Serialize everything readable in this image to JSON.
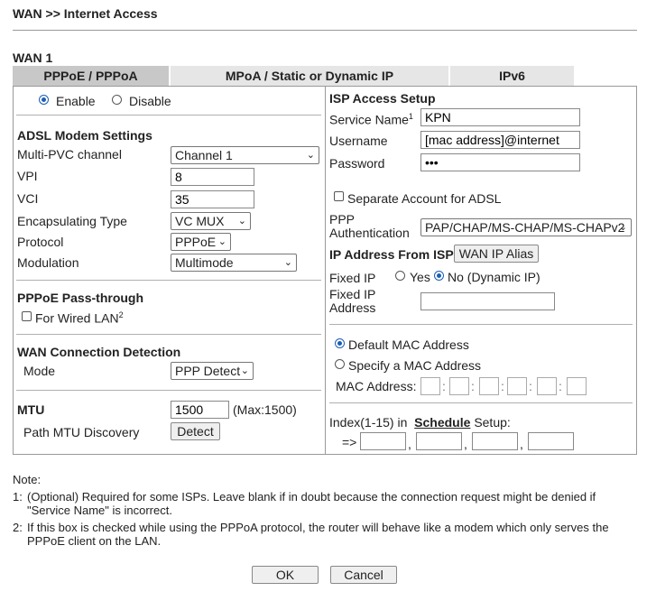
{
  "breadcrumb": "WAN >> Internet Access",
  "wan_title": "WAN 1",
  "tabs": [
    "PPPoE / PPPoA",
    "MPoA / Static or Dynamic IP",
    "IPv6"
  ],
  "left": {
    "enable": "Enable",
    "disable": "Disable",
    "adsl_title": "ADSL Modem Settings",
    "multipvc_label": "Multi-PVC channel",
    "multipvc_value": "Channel 1",
    "vpi_label": "VPI",
    "vpi_value": "8",
    "vci_label": "VCI",
    "vci_value": "35",
    "encap_label": "Encapsulating Type",
    "encap_value": "VC MUX",
    "protocol_label": "Protocol",
    "protocol_value": "PPPoE",
    "modulation_label": "Modulation",
    "modulation_value": "Multimode",
    "passthrough_title": "PPPoE Pass-through",
    "wired_lan": "For Wired LAN",
    "wired_lan_sup": "2",
    "detection_title": "WAN Connection Detection",
    "mode_label": "Mode",
    "mode_value": "PPP Detect",
    "mtu_label": "MTU",
    "mtu_value": "1500",
    "mtu_max": "(Max:1500)",
    "pmtu_label": "Path MTU Discovery",
    "detect_button": "Detect"
  },
  "right": {
    "isp_title": "ISP Access Setup",
    "service_name_label": "Service Name",
    "service_name_sup": "1",
    "service_name_value": "KPN",
    "username_label": "Username",
    "username_value": "[mac address]@internet",
    "password_label": "Password",
    "password_value": "•••",
    "separate_account": "Separate Account for ADSL",
    "ppp_auth_label_1": "PPP",
    "ppp_auth_label_2": "Authentication",
    "ppp_auth_value": "PAP/CHAP/MS-CHAP/MS-CHAPv2",
    "ip_from_isp": "IP Address From ISP",
    "wan_ip_alias": "WAN IP Alias",
    "fixed_ip_label": "Fixed IP",
    "fixed_ip_yes": "Yes",
    "fixed_ip_no": "No (Dynamic IP)",
    "fixed_ip_address_1": "Fixed IP",
    "fixed_ip_address_2": "Address",
    "default_mac": "Default MAC Address",
    "specify_mac": "Specify a MAC Address",
    "mac_address_label": "MAC Address:",
    "index_prefix": "Index(1-15) in",
    "schedule_link": "Schedule",
    "index_suffix": "Setup:",
    "arrow": "=>"
  },
  "notes": {
    "title": "Note:",
    "n1_num": "1:",
    "n1_line1": "(Optional) Required for some ISPs. Leave blank if in doubt because the connection request might be denied if",
    "n1_line2": "\"Service Name\" is incorrect.",
    "n2_num": "2:",
    "n2_line1": "If this box is checked while using the PPPoA protocol, the router will behave like a modem which only serves the",
    "n2_line2": "PPPoE client on the LAN."
  },
  "buttons": {
    "ok": "OK",
    "cancel": "Cancel"
  },
  "colors": {
    "accent": "#1a5fb4",
    "tab_active": "#c8c8c8",
    "tab_inactive": "#e6e6e6"
  }
}
